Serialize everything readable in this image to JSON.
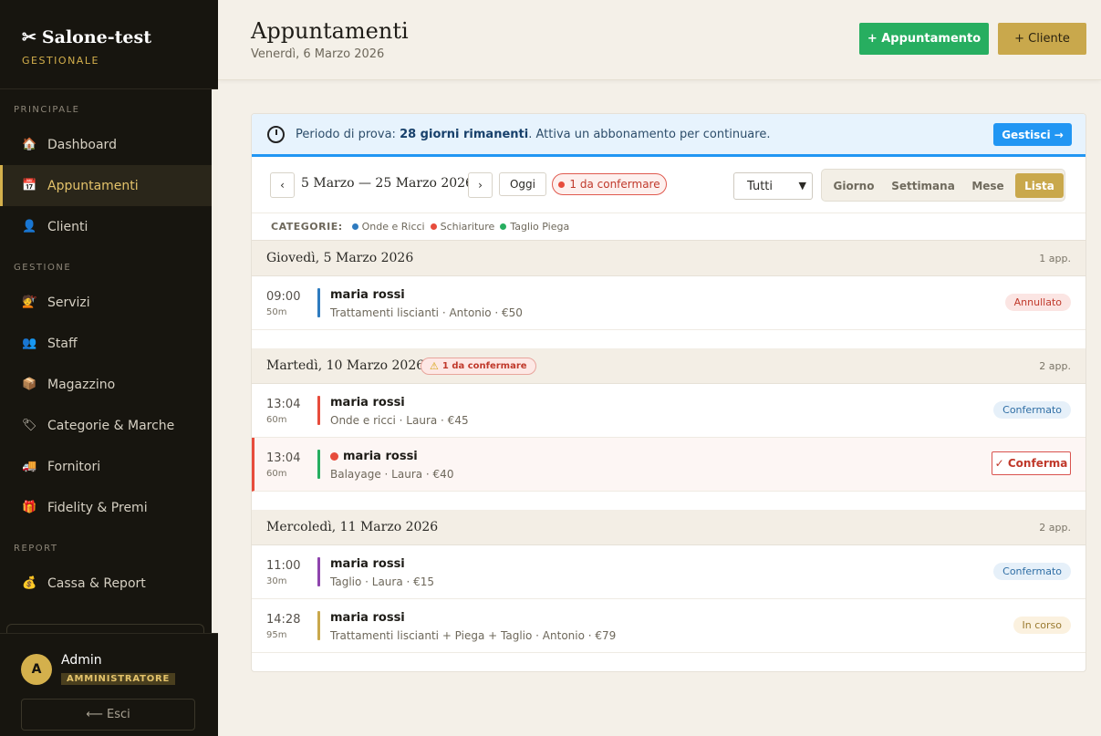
{
  "brand": {
    "title": "Salone-test",
    "subtitle": "GESTIONALE"
  },
  "sidebar": {
    "sections": [
      {
        "label": "PRINCIPALE"
      },
      {
        "label": "GESTIONE"
      },
      {
        "label": "REPORT"
      }
    ],
    "items": [
      {
        "label": "Dashboard",
        "icon": "🏠"
      },
      {
        "label": "Appuntamenti",
        "icon": "📅"
      },
      {
        "label": "Clienti",
        "icon": "👤"
      },
      {
        "label": "Servizi",
        "icon": "💇"
      },
      {
        "label": "Staff",
        "icon": "👥"
      },
      {
        "label": "Magazzino",
        "icon": "📦"
      },
      {
        "label": "Categorie & Marche",
        "icon": "🏷"
      },
      {
        "label": "Fornitori",
        "icon": "🚚"
      },
      {
        "label": "Fidelity & Premi",
        "icon": "🎁"
      },
      {
        "label": "Cassa & Report",
        "icon": "💰"
      }
    ]
  },
  "user": {
    "initial": "A",
    "name": "Admin",
    "role": "AMMINISTRATORE",
    "logout": "⟵ Esci"
  },
  "header": {
    "title": "Appuntamenti",
    "date": "Venerdì, 6 Marzo 2026",
    "new_appt": "+ Appuntamento",
    "new_client": "+ Cliente"
  },
  "trial": {
    "prefix": "Periodo di prova: ",
    "days": "28 giorni rimanenti",
    "suffix": ". Attiva un abbonamento per continuare.",
    "button": "Gestisci →"
  },
  "toolbar": {
    "prev": "‹",
    "next": "›",
    "range": "5 Marzo — 25 Marzo 2026",
    "today": "Oggi",
    "pending": "1 da confermare",
    "filter_value": "Tutti",
    "views": [
      "Giorno",
      "Settimana",
      "Mese",
      "Lista"
    ]
  },
  "categories": {
    "label": "CATEGORIE:",
    "items": [
      {
        "name": "Onde e Ricci",
        "color": "#2e7bbf"
      },
      {
        "name": "Schiariture",
        "color": "#e74c3c"
      },
      {
        "name": "Taglio Piega",
        "color": "#27ae60"
      }
    ]
  },
  "days": [
    {
      "title": "Giovedì, 5 Marzo 2026",
      "count": "1 app.",
      "appointments": [
        {
          "time": "09:00",
          "duration": "50m",
          "client": "maria rossi",
          "details": "Trattamenti liscianti · Antonio · €50",
          "color": "#2e7bbf",
          "status": "Annullato"
        }
      ]
    },
    {
      "title": "Martedì, 10 Marzo 2026",
      "warning": "1 da confermare",
      "count": "2 app.",
      "appointments": [
        {
          "time": "13:04",
          "duration": "60m",
          "client": "maria rossi",
          "details": "Onde e ricci · Laura · €45",
          "color": "#e74c3c",
          "status": "Confermato"
        },
        {
          "time": "13:04",
          "duration": "60m",
          "client": "maria rossi",
          "details": "Balayage · Laura · €40",
          "color": "#27ae60",
          "action": "✓ Conferma"
        }
      ]
    },
    {
      "title": "Mercoledì, 11 Marzo 2026",
      "count": "2 app.",
      "appointments": [
        {
          "time": "11:00",
          "duration": "30m",
          "client": "maria rossi",
          "details": "Taglio · Laura · €15",
          "color": "#8e44ad",
          "status": "Confermato"
        },
        {
          "time": "14:28",
          "duration": "95m",
          "client": "maria rossi",
          "details": "Trattamenti liscianti + Piega + Taglio · Antonio · €79",
          "color": "#c9a84c",
          "status": "In corso"
        }
      ]
    }
  ]
}
